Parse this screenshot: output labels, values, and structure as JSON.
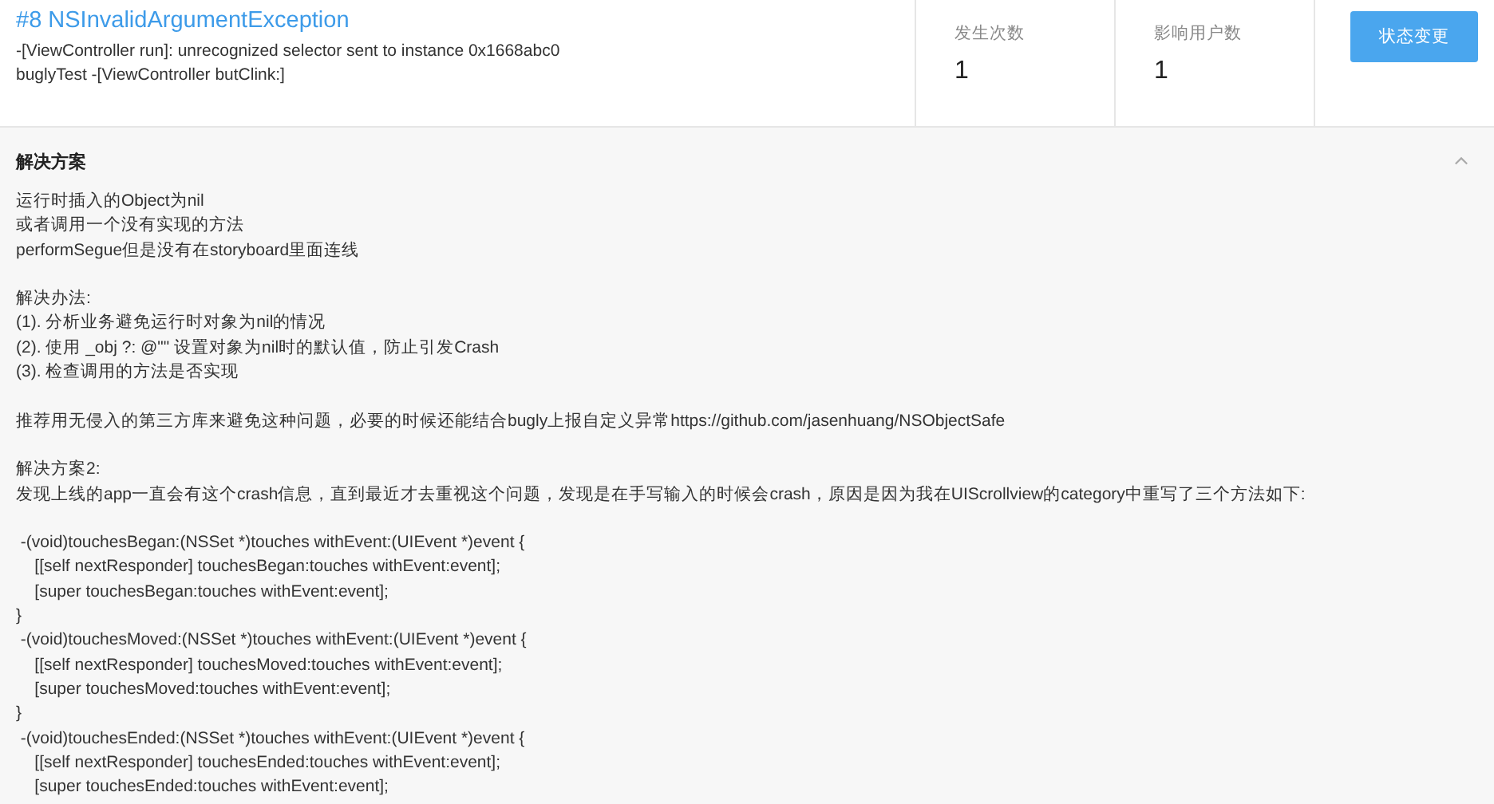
{
  "issue": {
    "title": "#8 NSInvalidArgumentException",
    "details": [
      "-[ViewController run]: unrecognized selector sent to instance 0x1668abc0",
      "buglyTest -[ViewController butClink:]"
    ]
  },
  "stats": [
    {
      "label": "发生次数",
      "value": "1"
    },
    {
      "label": "影响用户数",
      "value": "1"
    }
  ],
  "action_button": "状态变更",
  "solution": {
    "title": "解决方案",
    "expanded": true,
    "paragraphs": [
      [
        "运行时插入的Object为nil",
        "或者调用一个没有实现的方法",
        "performSegue但是没有在storyboard里面连线"
      ],
      [
        "解决办法:",
        "(1). 分析业务避免运行时对象为nil的情况",
        "(2). 使用 _obj ?: @\"\" 设置对象为nil时的默认值，防止引发Crash",
        "(3). 检查调用的方法是否实现"
      ],
      [
        "推荐用无侵入的第三方库来避免这种问题，必要的时候还能结合bugly上报自定义异常https://github.com/jasenhuang/NSObjectSafe"
      ],
      [
        "解决方案2:",
        "发现上线的app一直会有这个crash信息，直到最近才去重视这个问题，发现是在手写输入的时候会crash，原因是因为我在UIScrollview的category中重写了三个方法如下:"
      ],
      [
        " -(void)touchesBegan:(NSSet *)touches withEvent:(UIEvent *)event {",
        "    [[self nextResponder] touchesBegan:touches withEvent:event];",
        "    [super touchesBegan:touches withEvent:event];",
        "}",
        " -(void)touchesMoved:(NSSet *)touches withEvent:(UIEvent *)event {",
        "    [[self nextResponder] touchesMoved:touches withEvent:event];",
        "    [super touchesMoved:touches withEvent:event];",
        "}",
        " -(void)touchesEnded:(NSSet *)touches withEvent:(UIEvent *)event {",
        "    [[self nextResponder] touchesEnded:touches withEvent:event];",
        "    [super touchesEnded:touches withEvent:event];"
      ]
    ]
  }
}
